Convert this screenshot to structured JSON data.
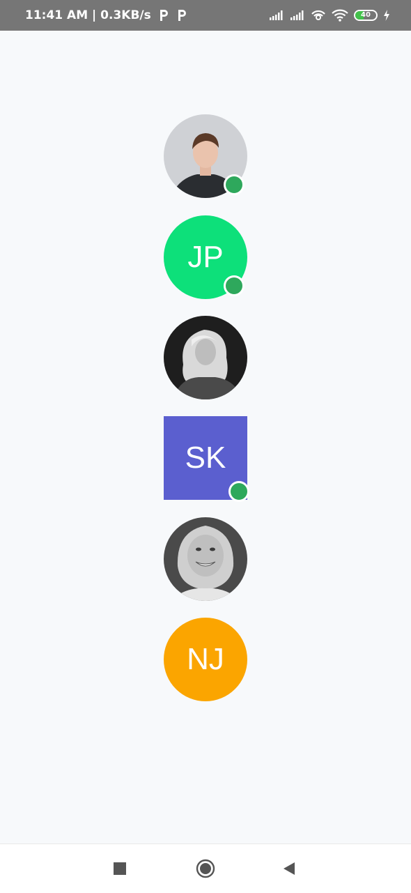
{
  "status_bar": {
    "time_speed": "11:41 AM | 0.3KB/s",
    "left_icons": [
      "p-app-icon",
      "p-app-icon"
    ],
    "right_icons": [
      "signal-icon",
      "signal-icon",
      "hotspot-icon",
      "wifi-icon",
      "battery-icon",
      "charging-icon"
    ],
    "battery_level": "40"
  },
  "avatars": [
    {
      "kind": "photo",
      "subject": "man-portrait",
      "shape": "circle",
      "online": true
    },
    {
      "kind": "initials",
      "initials": "JP",
      "color": "#0de07a",
      "shape": "circle",
      "online": true
    },
    {
      "kind": "photo",
      "subject": "woman-blonde-bw-portrait",
      "shape": "circle",
      "online": false
    },
    {
      "kind": "initials",
      "initials": "SK",
      "color": "#5b5fcf",
      "shape": "square",
      "online": true
    },
    {
      "kind": "photo",
      "subject": "woman-smiling-bw-portrait",
      "shape": "circle",
      "online": false
    },
    {
      "kind": "initials",
      "initials": "NJ",
      "color": "#fba500",
      "shape": "circle",
      "online": false
    }
  ],
  "colors": {
    "online_dot": "#2ea85c",
    "status_bar_bg": "#767676",
    "page_bg": "#f7f9fb",
    "nav_icon": "#555555"
  },
  "nav_bar": {
    "buttons": [
      "recents-square-icon",
      "home-circle-icon",
      "back-triangle-icon"
    ]
  }
}
